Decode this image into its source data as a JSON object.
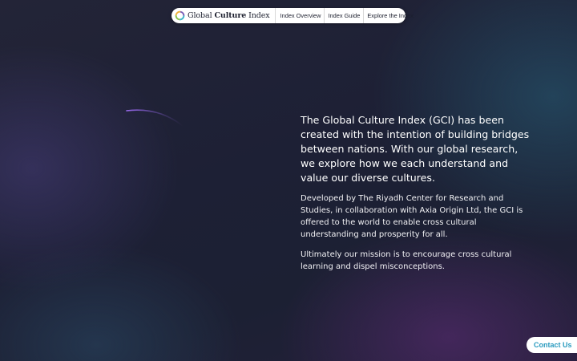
{
  "nav": {
    "logo": {
      "word1": "Global",
      "word2": "Culture",
      "word3": "Index",
      "mark_colors": [
        "#3fb6c9",
        "#8bc34a",
        "#f0b13c",
        "#7b5fb8"
      ]
    },
    "links": [
      {
        "label": "Index Overview"
      },
      {
        "label": "Index Guide"
      },
      {
        "label": "Explore the Index"
      }
    ]
  },
  "content": {
    "lead": "The Global Culture Index (GCI) has been created with the intention of building bridges between nations. With our global research, we explore how we each understand and value our diverse cultures.",
    "paragraphs": [
      "Developed by The Riyadh Center for Research and Studies, in collaboration with Axia Origin Ltd, the GCI is offered to the world to enable cross cultural understanding and prosperity for all.",
      "Ultimately our mission is to encourage cross cultural learning and dispel misconceptions."
    ]
  },
  "contact": {
    "label": "Contact Us",
    "color": "#2a9bbf"
  },
  "decor": {
    "arc_color": "#8a5fd8"
  }
}
